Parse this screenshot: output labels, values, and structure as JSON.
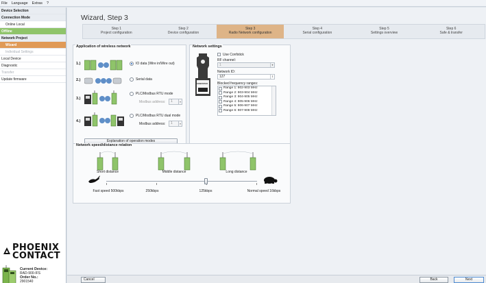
{
  "menu": [
    "File",
    "Language",
    "Extras",
    "?"
  ],
  "sidebar": {
    "items": [
      {
        "label": "Device Selection",
        "style": "group"
      },
      {
        "label": "Connection Mode",
        "style": "group"
      },
      {
        "label": "Online Local",
        "style": "sub"
      },
      {
        "label": "Offline",
        "style": "green"
      },
      {
        "label": "Network Project",
        "style": "group"
      },
      {
        "label": "Wizard",
        "style": "orange"
      },
      {
        "label": "Individual Settings",
        "style": "sub disabled"
      },
      {
        "label": "Local Device",
        "style": ""
      },
      {
        "label": "Diagnostic",
        "style": ""
      },
      {
        "label": "Transfer",
        "style": "disabled"
      },
      {
        "label": "Update firmware",
        "style": ""
      }
    ]
  },
  "logo": {
    "line1": "PHOENIX",
    "line2": "CONTACT"
  },
  "device": {
    "current_label": "Current Device:",
    "model": "RAD-900-IFS",
    "order_label": "Order No.:",
    "order_number": "2901540"
  },
  "wizard": {
    "title": "Wizard, Step 3",
    "steps": [
      {
        "num": "Step 1",
        "name": "Project configuration"
      },
      {
        "num": "Step 2",
        "name": "Device configuration"
      },
      {
        "num": "Step 3",
        "name": "Radio Network configuration",
        "active": true
      },
      {
        "num": "Step 4",
        "name": "Serial configuration"
      },
      {
        "num": "Step 5",
        "name": "Settings overview"
      },
      {
        "num": "Step 6",
        "name": "Safe & transfer"
      }
    ]
  },
  "application": {
    "title": "Application of wireless network",
    "options": [
      {
        "num": "1.)",
        "label": "IO data (Wire in/Wire out)",
        "selected": true
      },
      {
        "num": "2.)",
        "label": "Serial data",
        "selected": false
      },
      {
        "num": "3.)",
        "label": "PLC/Modbus RTU mode",
        "selected": false,
        "field_label": "Modbus address:",
        "field_value": "1"
      },
      {
        "num": "4.)",
        "label": "PLC/Modbus RTU dual mode",
        "selected": false,
        "field_label": "Modbus address:",
        "field_value": "1"
      }
    ],
    "explain_button": "Explanation of operation modes"
  },
  "network": {
    "title": "Network settings",
    "use_confstick": "Use Confstick",
    "rf_channel_label": "RF channel:",
    "rf_channel_value": "1",
    "network_id_label": "Network ID:",
    "network_id_value": "127",
    "blocked_label": "Blocked frequency ranges:",
    "ranges": [
      "Range 1: 902-903 MHz",
      "Range 2: 903-904 MHz",
      "Range 3: 904-905 MHz",
      "Range 4: 905-906 MHz",
      "Range 5: 906-907 MHz",
      "Range 6: 907-908 MHz"
    ],
    "confstick_label": "CONFSTICK"
  },
  "speed": {
    "title": "Network speed/distance relation",
    "distances": [
      "Short distance",
      "Middle distance",
      "Long distance"
    ],
    "speeds": [
      "Fast speed 500kbps",
      "250kbps",
      "125kbps",
      "Normal speed 16kbps"
    ],
    "selected_index": 2
  },
  "footer": {
    "cancel": "Cancel",
    "back": "Back",
    "next": "Next"
  },
  "colors": {
    "accent_orange": "#deb487",
    "sidebar_green": "#8fc46a",
    "sidebar_orange": "#e09a57"
  }
}
